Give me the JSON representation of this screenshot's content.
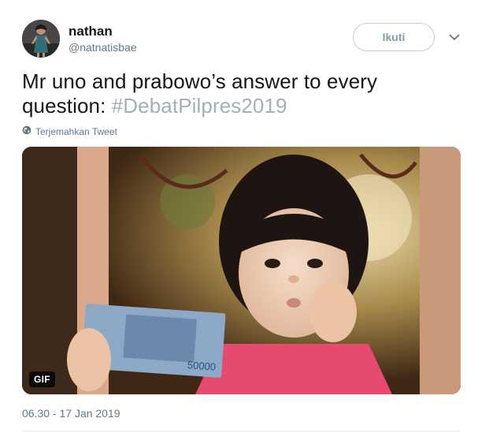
{
  "user": {
    "name": "nathan",
    "handle": "@natnatisbae"
  },
  "follow_button": {
    "label": "Ikuti"
  },
  "tweet": {
    "text": "Mr uno and prabowo’s answer to every question: ",
    "hashtag": "#DebatPilpres2019",
    "translate_label": "Terjemahkan Tweet",
    "timestamp": "06.30 - 17 Jan 2019"
  },
  "media": {
    "type_badge": "GIF",
    "banknote_value": "50000"
  },
  "colors": {
    "text": "#14171a",
    "secondary": "#657786",
    "hashtag": "#a5afb8",
    "button_border": "#c3ccd4"
  },
  "icons": {
    "translate": "globe-icon",
    "menu": "chevron-down-icon"
  }
}
